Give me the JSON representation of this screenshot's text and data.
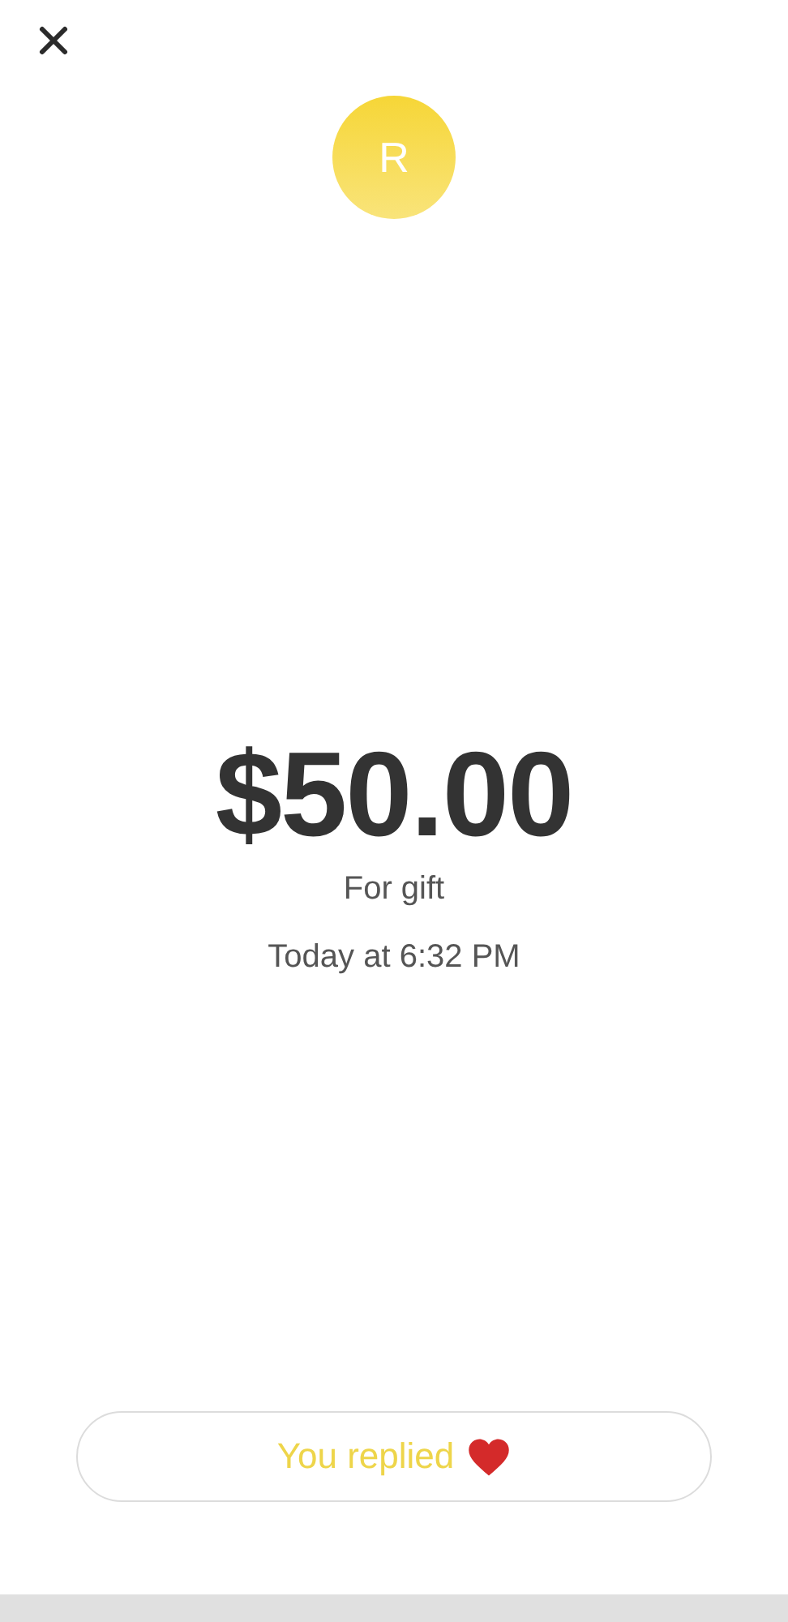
{
  "avatar": {
    "initial": "R"
  },
  "amount": "$50.00",
  "note": "For gift",
  "time": "Today at 6:32 PM",
  "reply_button": {
    "label": "You replied"
  }
}
